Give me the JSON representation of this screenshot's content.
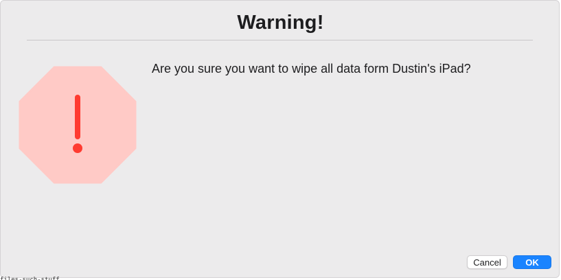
{
  "dialog": {
    "title": "Warning!",
    "message": "Are you sure you want to wipe all data form Dustin's iPad?",
    "icon": "stop-warning-icon",
    "icon_fill": "#ffcac6",
    "icon_glyph_color": "#ff3b30",
    "buttons": {
      "cancel_label": "Cancel",
      "ok_label": "OK"
    },
    "accent_color": "#1a84ff"
  },
  "background_text": "files-such-stuff"
}
